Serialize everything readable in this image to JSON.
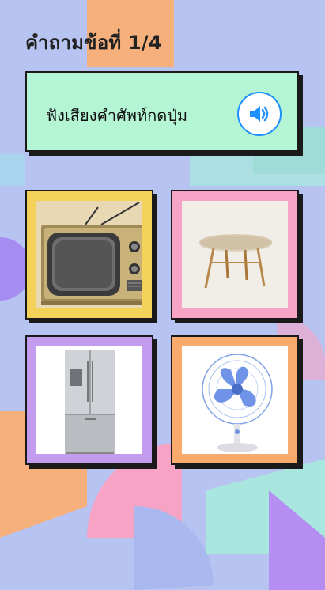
{
  "header": {
    "title": "คำถามข้อที่ 1/4"
  },
  "prompt": {
    "text": "ฟังเสียงคำศัพท์กดปุ่ม",
    "speaker_icon": "speaker-icon"
  },
  "options": [
    {
      "id": "tv",
      "image": "retro-television",
      "frame_color": "#f4d25a"
    },
    {
      "id": "table",
      "image": "round-wooden-table",
      "frame_color": "#f7a3c6"
    },
    {
      "id": "fridge",
      "image": "steel-refrigerator",
      "frame_color": "#c39cf0"
    },
    {
      "id": "fan",
      "image": "blue-electric-fan",
      "frame_color": "#f8ab6d"
    }
  ],
  "colors": {
    "background": "#b7c4f2",
    "prompt_bg": "#b4f5d6",
    "accent": "#1e90ff"
  }
}
